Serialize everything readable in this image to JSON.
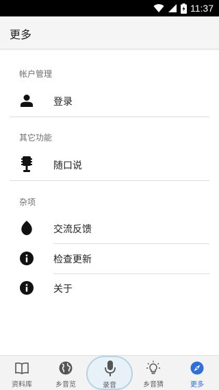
{
  "status_bar": {
    "time": "11:37"
  },
  "app_bar": {
    "title": "更多"
  },
  "sections": [
    {
      "header": "帐户管理",
      "items": [
        {
          "label": "登录",
          "icon": "person-icon"
        }
      ]
    },
    {
      "header": "其它功能",
      "items": [
        {
          "label": "随口说",
          "icon": "microphone-icon"
        }
      ]
    },
    {
      "header": "杂项",
      "items": [
        {
          "label": "交流反馈",
          "icon": "leaf-icon"
        },
        {
          "label": "检查更新",
          "icon": "info-icon"
        },
        {
          "label": "关于",
          "icon": "info-icon"
        }
      ]
    }
  ],
  "bottom_nav": {
    "active_index": 4,
    "accent_color": "#2f6fd6",
    "items": [
      {
        "label": "资料库",
        "icon": "book-icon"
      },
      {
        "label": "乡音览",
        "icon": "globe-icon"
      },
      {
        "label": "录音",
        "icon": "microphone-icon"
      },
      {
        "label": "乡音猜",
        "icon": "lightbulb-icon"
      },
      {
        "label": "更多",
        "icon": "compass-icon"
      }
    ]
  }
}
